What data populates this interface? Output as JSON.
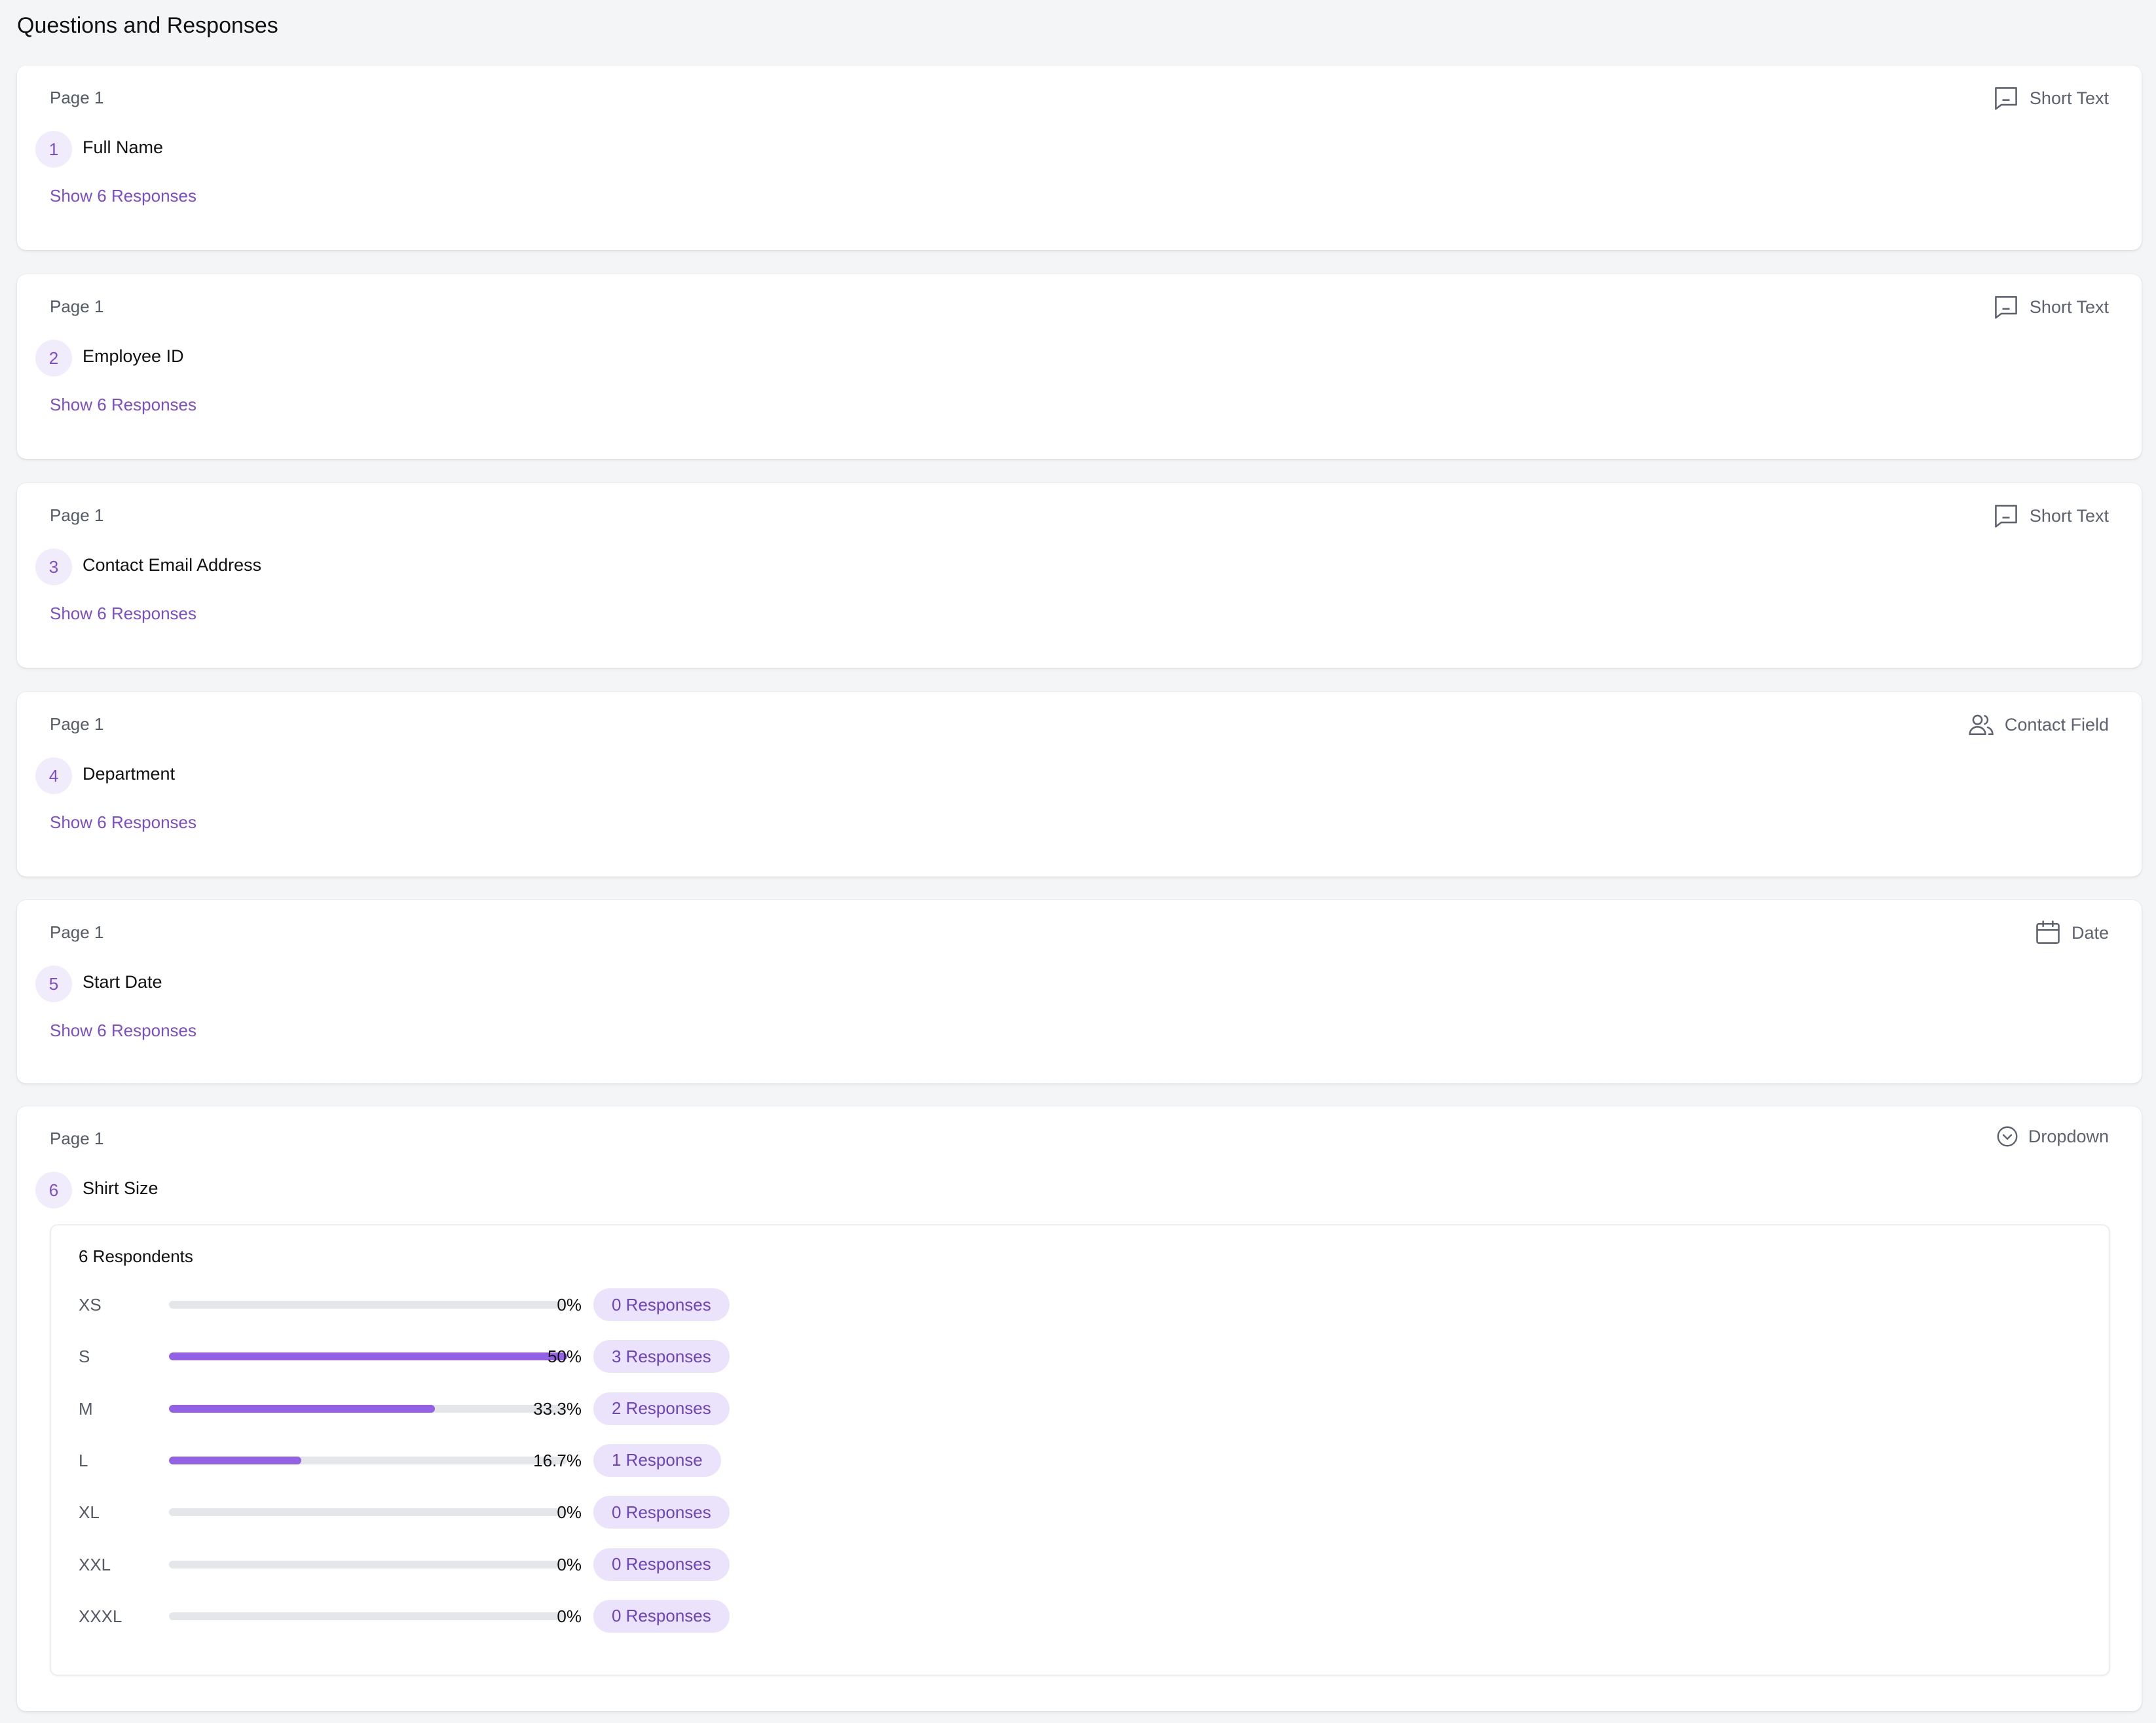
{
  "header": {
    "title": "Questions and Responses"
  },
  "questions": [
    {
      "page": "Page 1",
      "number": "1",
      "title": "Full Name",
      "type": "Short Text",
      "icon": "short-text-icon",
      "link": "Show 6 Responses"
    },
    {
      "page": "Page 1",
      "number": "2",
      "title": "Employee ID",
      "type": "Short Text",
      "icon": "short-text-icon",
      "link": "Show 6 Responses"
    },
    {
      "page": "Page 1",
      "number": "3",
      "title": "Contact Email Address",
      "type": "Short Text",
      "icon": "short-text-icon",
      "link": "Show 6 Responses"
    },
    {
      "page": "Page 1",
      "number": "4",
      "title": "Department",
      "type": "Contact Field",
      "icon": "contact-field-icon",
      "link": "Show 6 Responses"
    },
    {
      "page": "Page 1",
      "number": "5",
      "title": "Start Date",
      "type": "Date",
      "icon": "calendar-icon",
      "link": "Show 6 Responses"
    },
    {
      "page": "Page 1",
      "number": "6",
      "title": "Shirt Size",
      "type": "Dropdown",
      "icon": "dropdown-icon",
      "results": {
        "respondents": "6 Respondents",
        "options": [
          {
            "label": "XS",
            "percent_text": "0%",
            "fraction": 0,
            "count_text": "0 Responses"
          },
          {
            "label": "S",
            "percent_text": "50%",
            "fraction": 1.0,
            "count_text": "3 Responses"
          },
          {
            "label": "M",
            "percent_text": "33.3%",
            "fraction": 0.667,
            "count_text": "2 Responses"
          },
          {
            "label": "L",
            "percent_text": "16.7%",
            "fraction": 0.333,
            "count_text": "1 Response"
          },
          {
            "label": "XL",
            "percent_text": "0%",
            "fraction": 0,
            "count_text": "0 Responses"
          },
          {
            "label": "XXL",
            "percent_text": "0%",
            "fraction": 0,
            "count_text": "0 Responses"
          },
          {
            "label": "XXXL",
            "percent_text": "0%",
            "fraction": 0,
            "count_text": "0 Responses"
          }
        ]
      }
    }
  ],
  "colors": {
    "accent": "#7c4dca",
    "bar": "#9361e6",
    "pill_bg": "#ebe3fb"
  }
}
